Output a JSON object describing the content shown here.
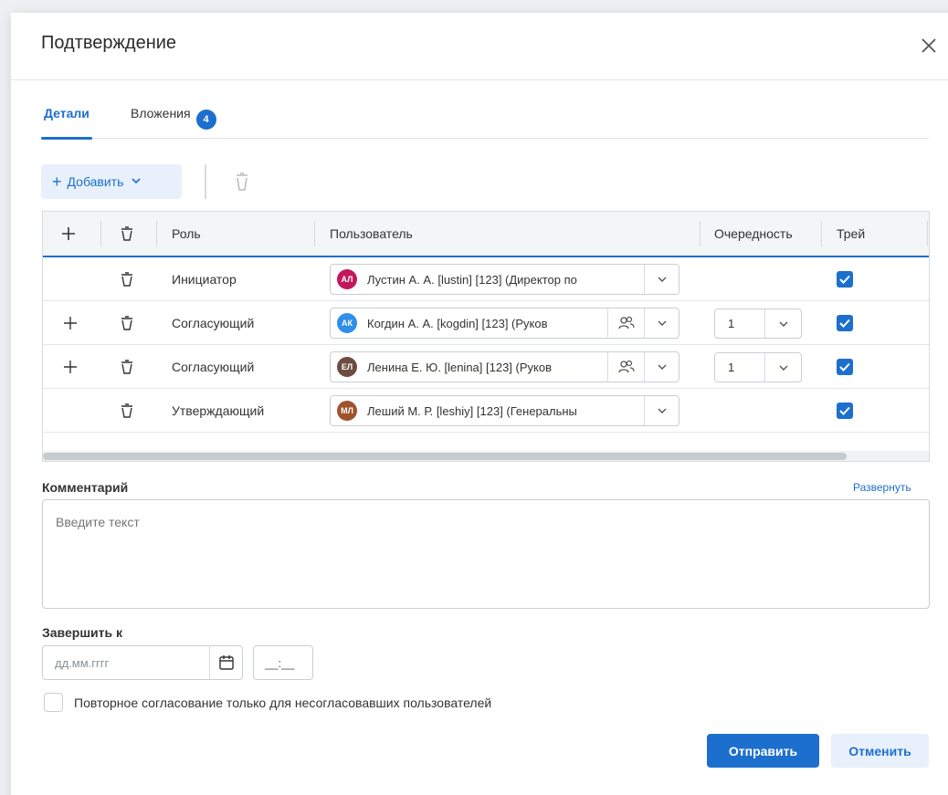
{
  "dialog": {
    "title": "Подтверждение"
  },
  "tabs": [
    {
      "label": "Детали",
      "active": true
    },
    {
      "label": "Вложения",
      "badge": "4"
    }
  ],
  "toolbar": {
    "add_label": "Добавить"
  },
  "grid": {
    "columns": {
      "role": "Роль",
      "user": "Пользователь",
      "order": "Очередность",
      "track": "Трей"
    },
    "rows": [
      {
        "role": "Инициатор",
        "user": "Лустин А. А. [lustin] [123] (Директор по",
        "initials": "АЛ",
        "avatar_color": "#c2185b",
        "order": "",
        "checked": true,
        "has_add": false,
        "has_group": false
      },
      {
        "role": "Согласующий",
        "user": "Когдин А. А. [kogdin] [123] (Руков",
        "initials": "АК",
        "avatar_color": "#2f8ee8",
        "order": "1",
        "checked": true,
        "has_add": true,
        "has_group": true
      },
      {
        "role": "Согласующий",
        "user": "Ленина Е. Ю. [lenina] [123] (Руков",
        "initials": "ЕЛ",
        "avatar_color": "#6d4c41",
        "order": "1",
        "checked": true,
        "has_add": true,
        "has_group": true
      },
      {
        "role": "Утверждающий",
        "user": "Леший М. Р. [leshiy] [123] (Генеральны",
        "initials": "МЛ",
        "avatar_color": "#a0522d",
        "order": "",
        "checked": true,
        "has_add": false,
        "has_group": false
      }
    ]
  },
  "comment": {
    "label": "Комментарий",
    "expand": "Развернуть",
    "placeholder": "Введите текст"
  },
  "deadline": {
    "label": "Завершить к",
    "date_placeholder": "дд.мм.гггг",
    "time_placeholder": "__:__"
  },
  "recheck": {
    "label": "Повторное согласование только для несогласовавших пользователей",
    "checked": false
  },
  "actions": {
    "send": "Отправить",
    "cancel": "Отменить"
  },
  "colors": {
    "accent": "#1d6fce",
    "accent_light": "#e8f0fb"
  }
}
